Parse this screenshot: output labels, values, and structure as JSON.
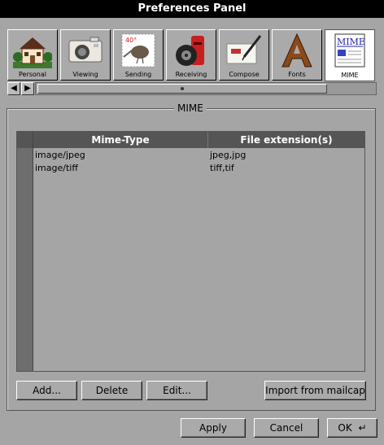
{
  "window": {
    "title": "Preferences Panel"
  },
  "tabs": [
    {
      "label": "Personal",
      "icon": "house-icon"
    },
    {
      "label": "Viewing",
      "icon": "camera-icon"
    },
    {
      "label": "Sending",
      "icon": "stamp-icon"
    },
    {
      "label": "Receiving",
      "icon": "mailbox-icon"
    },
    {
      "label": "Compose",
      "icon": "pen-letter-icon"
    },
    {
      "label": "Fonts",
      "icon": "letter-a-icon"
    },
    {
      "label": "MIME",
      "icon": "mime-document-icon",
      "active": true
    }
  ],
  "tab_scroll": {
    "left_arrow": "◀",
    "right_arrow": "▶"
  },
  "group": {
    "title": "MIME"
  },
  "table": {
    "columns": [
      "Mime-Type",
      "File extension(s)"
    ],
    "rows": [
      [
        "image/jpeg",
        "jpeg,jpg"
      ],
      [
        "image/tiff",
        "tiff,tif"
      ]
    ]
  },
  "actions": {
    "add": "Add...",
    "delete": "Delete",
    "edit": "Edit...",
    "import": "Import from mailcap"
  },
  "footer": {
    "apply": "Apply",
    "cancel": "Cancel",
    "ok": "OK",
    "ok_glyph": "↵"
  }
}
